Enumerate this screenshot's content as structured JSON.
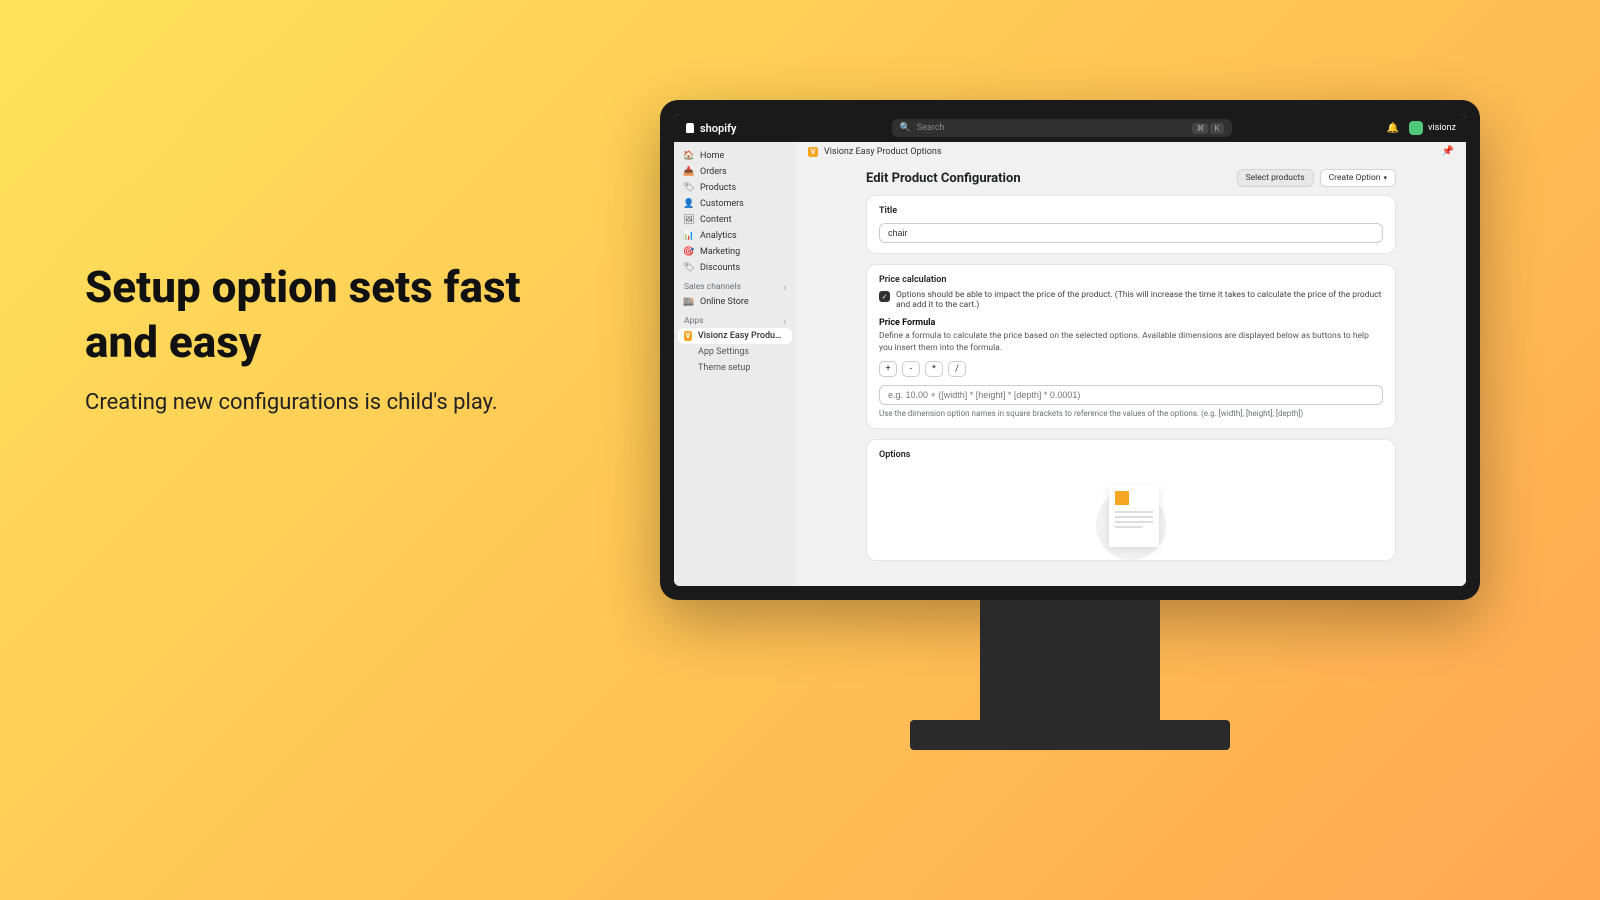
{
  "hero": {
    "title": "Setup option sets fast and easy",
    "subtitle": "Creating new configurations is child's play."
  },
  "topbar": {
    "brand": "shopify",
    "search_placeholder": "Search",
    "kbd1": "⌘",
    "kbd2": "K",
    "account_name": "visionz"
  },
  "sidebar": {
    "home": "Home",
    "orders": "Orders",
    "products": "Products",
    "customers": "Customers",
    "content": "Content",
    "analytics": "Analytics",
    "marketing": "Marketing",
    "discounts": "Discounts",
    "sales_channels": "Sales channels",
    "online_store": "Online Store",
    "apps": "Apps",
    "app_name": "Visionz Easy Product Opti...",
    "app_settings": "App Settings",
    "theme_setup": "Theme setup"
  },
  "main": {
    "breadcrumb": "Visionz Easy Product Options",
    "page_title": "Edit Product Configuration",
    "select_products": "Select products",
    "create_option": "Create Option",
    "title_label": "Title",
    "title_value": "chair",
    "price_calc_label": "Price calculation",
    "price_check_text": "Options should be able to impact the price of the product. (This will increase the time it takes to calculate the price of the product and add it to the cart.)",
    "price_formula_label": "Price Formula",
    "price_formula_help": "Define a formula to calculate the price based on the selected options. Available dimensions are displayed below as buttons to help you insert them into the formula.",
    "op_plus": "+",
    "op_minus": "-",
    "op_mult": "*",
    "op_div": "/",
    "formula_placeholder": "e.g. 10.00 + ([width] * [height] * [depth] * 0.0001)",
    "formula_hint": "Use the dimension option names in square brackets to reference the values of the options. (e.g. [width], [height], [depth])",
    "options_label": "Options"
  }
}
